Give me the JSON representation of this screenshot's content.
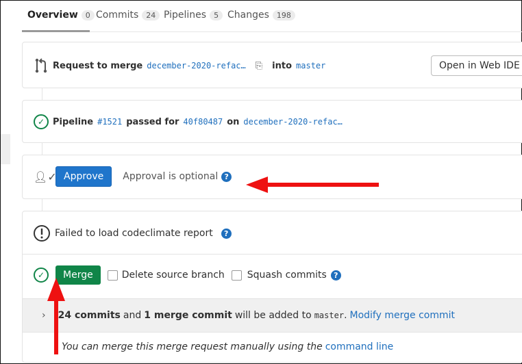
{
  "tabs": [
    {
      "label": "Overview",
      "count": "0"
    },
    {
      "label": "Commits",
      "count": "24"
    },
    {
      "label": "Pipelines",
      "count": "5"
    },
    {
      "label": "Changes",
      "count": "198"
    }
  ],
  "header": {
    "request_label": "Request to merge",
    "source_branch": "december-2020-refac…",
    "into_label": "into",
    "target_branch": "master",
    "web_ide_button": "Open in Web IDE"
  },
  "pipeline": {
    "label": "Pipeline",
    "id": "#1521",
    "passed_for": "passed for",
    "commit": "40f80487",
    "on": "on",
    "branch": "december-2020-refac…"
  },
  "approval": {
    "button": "Approve",
    "text": "Approval is optional"
  },
  "codeclimate": {
    "text": "Failed to load codeclimate report"
  },
  "merge": {
    "button": "Merge",
    "delete_source": "Delete source branch",
    "squash": "Squash commits"
  },
  "commits_info": {
    "commits": "24 commits",
    "and": "and",
    "merge_commit": "1 merge commit",
    "added_to": "will be added to",
    "branch": "master",
    "period": ".",
    "modify_link": "Modify merge commit"
  },
  "manual": {
    "text": "You can merge this merge request manually using the",
    "link": "command line"
  },
  "colors": {
    "blue": "#1f75cb",
    "green": "#108548",
    "arrow": "#ee1111"
  }
}
